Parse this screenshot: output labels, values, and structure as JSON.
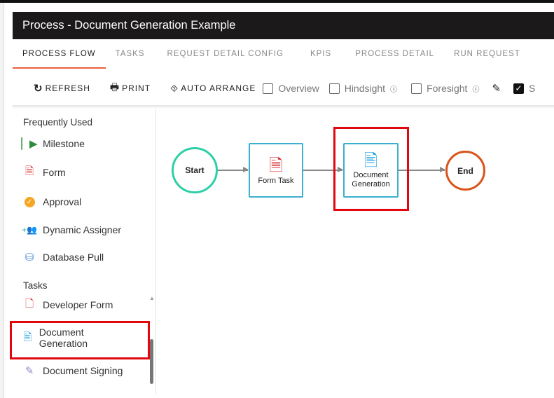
{
  "window": {
    "title": "Process - Document Generation Example"
  },
  "tabs": [
    {
      "label": "PROCESS FLOW",
      "active": true
    },
    {
      "label": "TASKS"
    },
    {
      "label": "REQUEST DETAIL CONFIG"
    },
    {
      "label": "KPIS"
    },
    {
      "label": "PROCESS DETAIL"
    },
    {
      "label": "RUN REQUEST"
    }
  ],
  "toolbar": {
    "refresh": "REFRESH",
    "print": "PRINT",
    "auto_arrange": "AUTO ARRANGE",
    "overview": {
      "label": "Overview",
      "checked": false
    },
    "hindsight": {
      "label": "Hindsight",
      "checked": false
    },
    "foresight": {
      "label": "Foresight",
      "checked": false
    },
    "truncated": {
      "label": "S",
      "checked": true
    }
  },
  "sidebar": {
    "frequently_used": "Frequently Used",
    "items": [
      {
        "label": "Milestone",
        "icon": "flag-icon"
      },
      {
        "label": "Form",
        "icon": "form-icon"
      },
      {
        "label": "Approval",
        "icon": "approval-badge-icon"
      },
      {
        "label": "Dynamic Assigner",
        "icon": "add-users-icon"
      },
      {
        "label": "Database Pull",
        "icon": "database-icon"
      }
    ],
    "tasks": "Tasks",
    "task_items": [
      {
        "label": "Developer Form",
        "icon": "developer-form-icon"
      },
      {
        "label": "Document Generation",
        "icon": "document-generation-icon"
      },
      {
        "label": "Document Signing",
        "icon": "signing-pen-icon"
      }
    ]
  },
  "flow": {
    "start": "Start",
    "form_task": "Form Task",
    "doc_gen": "Document Generation",
    "end": "End"
  },
  "colors": {
    "start": "#2ecfa8",
    "end": "#d9541a",
    "task_border": "#3bb0d1",
    "highlight": "#e0070f",
    "active_tab": "#e8603c"
  }
}
